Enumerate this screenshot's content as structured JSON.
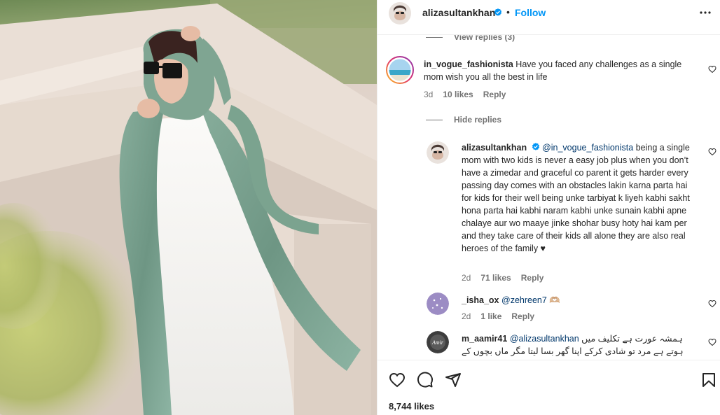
{
  "post": {
    "author": "alizasultankhan",
    "follow_label": "Follow",
    "separator": "•",
    "likes_count": "8,744 likes"
  },
  "comments": {
    "view_replies": "View replies (3)",
    "hide_replies": "Hide replies",
    "items": [
      {
        "username": "in_vogue_fashionista",
        "text": "Have you faced any challenges as a single mom wish you all the best in life",
        "time": "3d",
        "likes": "10 likes",
        "reply": "Reply"
      }
    ],
    "replies": [
      {
        "username": "alizasultankhan",
        "mention": "@in_vogue_fashionista",
        "text": "being a single mom with two kids is never a easy job plus when you don’t have a zimedar and graceful co parent it gets harder every passing day comes with an obstacles lakin karna parta hai for kids for their well being unke tarbiyat k liyeh kabhi sakht hona parta hai kabhi naram kabhi unke sunain kabhi apne chalaye aur wo maaye jinke shohar busy hoty hai kam per and they take care of their kids all alone they are also real heroes of the family ♥",
        "time": "2d",
        "likes": "71 likes",
        "reply": "Reply"
      },
      {
        "username": "_isha_ox",
        "mention": "@zehreen7",
        "text": "🫶🏼",
        "time": "2d",
        "likes": "1 like",
        "reply": "Reply"
      },
      {
        "username": "m_aamir41",
        "mention": "@alizasultankhan",
        "text": "ہمشہ عورت ہے تکلیف میں ہوتے ہے مرد تو شادی کرکے اپنا گھر بسا لیتا مگر ماں بچوں کے",
        "avatar_text": "Amir"
      }
    ]
  },
  "icons": {
    "more": "more-options-icon",
    "heart": "heart-icon",
    "comment": "comment-icon",
    "share": "share-icon",
    "save": "bookmark-icon",
    "verified": "verified-badge-icon"
  },
  "colors": {
    "link": "#0095f6",
    "mention": "#00376b",
    "secondary": "#737373",
    "verified": "#0095f6"
  }
}
